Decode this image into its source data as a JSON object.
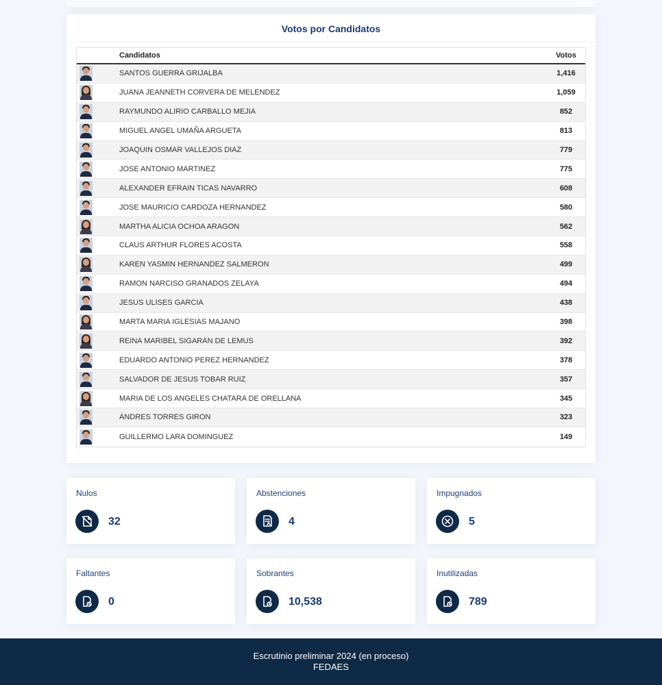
{
  "results": {
    "title": "Votos por Candidatos",
    "columns": {
      "candidates": "Candidatos",
      "votes": "Votos"
    },
    "rows": [
      {
        "name": "SANTOS GUERRA GRIJALBA",
        "votes": "1,416",
        "photo": "male-candidate-photo"
      },
      {
        "name": "JUANA JEANNETH CORVERA DE MELENDEZ",
        "votes": "1,059",
        "photo": "female-candidate-photo"
      },
      {
        "name": "RAYMUNDO ALIRIO CARBALLO MEJIA",
        "votes": "852",
        "photo": "male-candidate-photo"
      },
      {
        "name": "MIGUEL ANGEL UMAÑA ARGUETA",
        "votes": "813",
        "photo": "male-candidate-photo"
      },
      {
        "name": "JOAQUIN OSMAR VALLEJOS DIAZ",
        "votes": "779",
        "photo": "male-candidate-photo"
      },
      {
        "name": "JOSE ANTONIO MARTINEZ",
        "votes": "775",
        "photo": "male-candidate-photo"
      },
      {
        "name": "ALEXANDER EFRAIN TICAS NAVARRO",
        "votes": "608",
        "photo": "male-candidate-photo"
      },
      {
        "name": "JOSE MAURICIO CARDOZA HERNANDEZ",
        "votes": "580",
        "photo": "male-candidate-photo"
      },
      {
        "name": "MARTHA ALICIA OCHOA ARAGON",
        "votes": "562",
        "photo": "female-candidate-photo"
      },
      {
        "name": "CLAUS ARTHUR FLORES ACOSTA",
        "votes": "558",
        "photo": "male-candidate-photo"
      },
      {
        "name": "KAREN YASMIN HERNANDEZ SALMERON",
        "votes": "499",
        "photo": "female-candidate-photo"
      },
      {
        "name": "RAMON NARCISO GRANADOS ZELAYA",
        "votes": "494",
        "photo": "male-candidate-photo"
      },
      {
        "name": "JESUS ULISES GARCIA",
        "votes": "438",
        "photo": "male-candidate-photo"
      },
      {
        "name": "MARTA MARIA IGLESIAS MAJANO",
        "votes": "398",
        "photo": "female-candidate-photo"
      },
      {
        "name": "REINA MARIBEL SIGARAN DE LEMUS",
        "votes": "392",
        "photo": "female-candidate-photo"
      },
      {
        "name": "EDUARDO ANTONIO PEREZ HERNANDEZ",
        "votes": "378",
        "photo": "male-candidate-photo"
      },
      {
        "name": "SALVADOR DE JESUS TOBAR RUIZ",
        "votes": "357",
        "photo": "male-candidate-photo"
      },
      {
        "name": "MARIA DE LOS ANGELES CHATARA DE ORELLANA",
        "votes": "345",
        "photo": "female-candidate-photo"
      },
      {
        "name": "ANDRES TORRES GIRON",
        "votes": "323",
        "photo": "male-candidate-photo"
      },
      {
        "name": "GUILLERMO LARA DOMINGUEZ",
        "votes": "149",
        "photo": "male-candidate-photo"
      }
    ]
  },
  "stats": [
    {
      "label": "Nulos",
      "value": "32",
      "icon": "void-ballot-icon"
    },
    {
      "label": "Abstenciones",
      "value": "4",
      "icon": "abstention-document-icon"
    },
    {
      "label": "Impugnados",
      "value": "5",
      "icon": "circle-x-icon"
    },
    {
      "label": "Faltantes",
      "value": "0",
      "icon": "document-clock-icon"
    },
    {
      "label": "Sobrantes",
      "value": "10,538",
      "icon": "document-clock-icon"
    },
    {
      "label": "Inutilizadas",
      "value": "789",
      "icon": "document-clock-icon"
    }
  ],
  "footer": {
    "line1": "Escrutinio preliminar 2024 (en proceso)",
    "line2": "FEDAES"
  },
  "colors": {
    "navy": "#0f2a47",
    "title_blue": "#173a73",
    "background": "#f3f6fc"
  }
}
